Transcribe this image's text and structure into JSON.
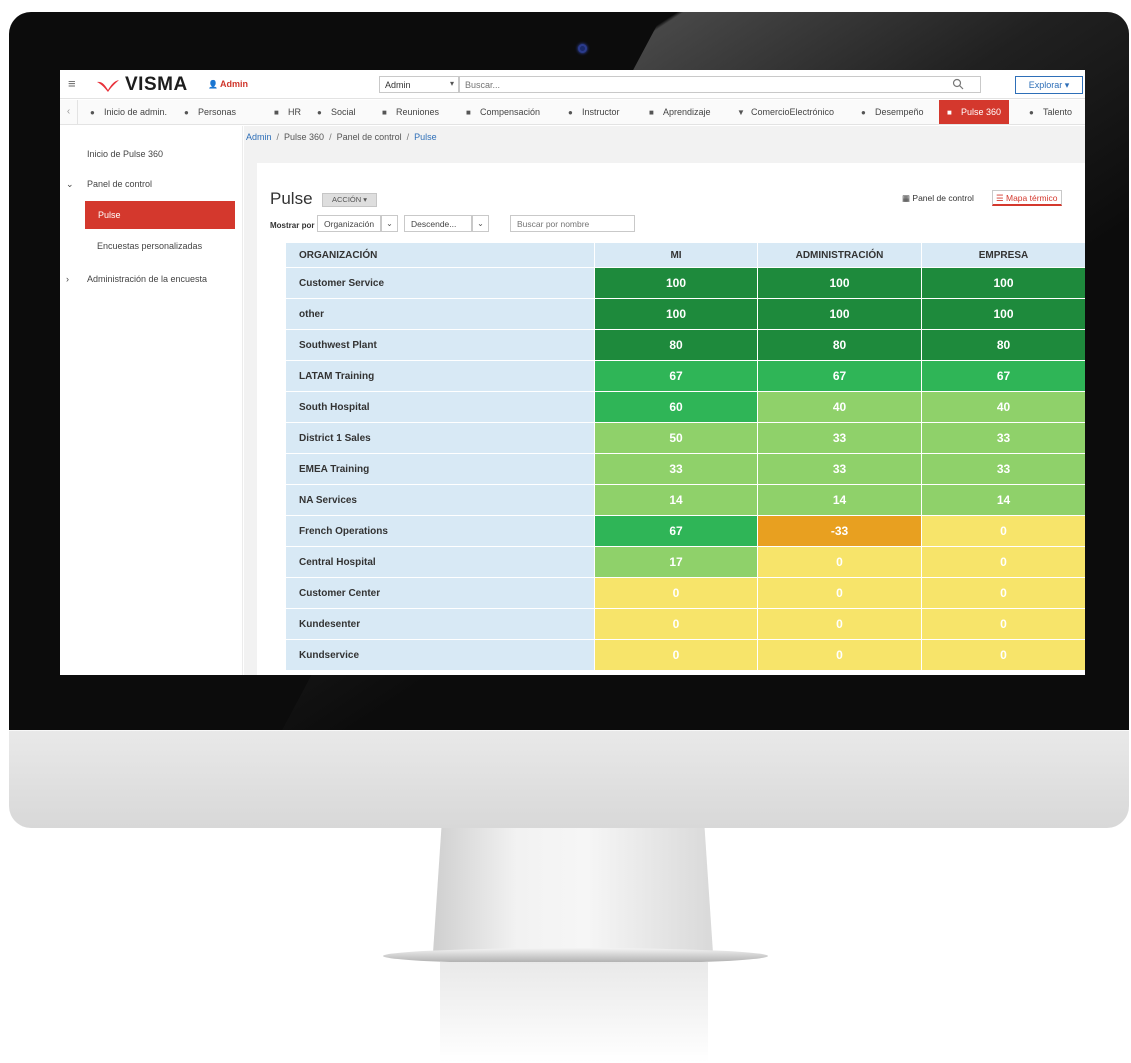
{
  "topbar": {
    "logo_text": "VISMA",
    "admin_label": "Admin",
    "scope_select": "Admin",
    "search_placeholder": "Buscar...",
    "explore_label": "Explorar"
  },
  "nav": {
    "items": [
      {
        "label": "Inicio de admin.",
        "icon": "home-admin-icon"
      },
      {
        "label": "Personas",
        "icon": "people-icon"
      },
      {
        "label": "HR",
        "icon": "hr-icon"
      },
      {
        "label": "Social",
        "icon": "social-icon"
      },
      {
        "label": "Reuniones",
        "icon": "meetings-icon"
      },
      {
        "label": "Compensación",
        "icon": "compensation-icon"
      },
      {
        "label": "Instructor",
        "icon": "instructor-icon"
      },
      {
        "label": "Aprendizaje",
        "icon": "learning-icon"
      },
      {
        "label": "ComercioElectrónico",
        "icon": "ecommerce-icon"
      },
      {
        "label": "Desempeño",
        "icon": "performance-icon"
      },
      {
        "label": "Pulse 360",
        "icon": "pulse-icon",
        "active": true
      },
      {
        "label": "Talento",
        "icon": "talent-icon"
      }
    ]
  },
  "sidebar": {
    "home": "Inicio de Pulse 360",
    "dashboard": "Panel de control",
    "active": "Pulse",
    "custom_surveys": "Encuestas personalizadas",
    "survey_admin": "Administración de la encuesta"
  },
  "breadcrumb": [
    "Admin",
    "Pulse 360",
    "Panel de control",
    "Pulse"
  ],
  "main": {
    "title": "Pulse",
    "action_label": "ACCIÓN",
    "view_dashboard": "Panel de control",
    "view_heatmap": "Mapa térmico",
    "show_by_label": "Mostrar por",
    "group_select": "Organización",
    "sort_select": "Descende...",
    "name_search_placeholder": "Buscar por nombre"
  },
  "heatmap": {
    "columns": [
      "ORGANIZACIÓN",
      "MI",
      "ADMINISTRACIÓN",
      "EMPRESA"
    ],
    "rows": [
      {
        "org": "Customer Service",
        "values": [
          "100",
          "100",
          "100"
        ]
      },
      {
        "org": "other",
        "values": [
          "100",
          "100",
          "100"
        ]
      },
      {
        "org": "Southwest Plant",
        "values": [
          "80",
          "80",
          "80"
        ]
      },
      {
        "org": "LATAM Training",
        "values": [
          "67",
          "67",
          "67"
        ]
      },
      {
        "org": "South Hospital",
        "values": [
          "60",
          "40",
          "40"
        ]
      },
      {
        "org": "District 1 Sales",
        "values": [
          "50",
          "33",
          "33"
        ]
      },
      {
        "org": "EMEA Training",
        "values": [
          "33",
          "33",
          "33"
        ]
      },
      {
        "org": "NA Services",
        "values": [
          "14",
          "14",
          "14"
        ]
      },
      {
        "org": "French Operations",
        "values": [
          "67",
          "-33",
          "0"
        ]
      },
      {
        "org": "Central Hospital",
        "values": [
          "17",
          "0",
          "0"
        ]
      },
      {
        "org": "Customer Center",
        "values": [
          "0",
          "0",
          "0"
        ]
      },
      {
        "org": "Kundesenter",
        "values": [
          "0",
          "0",
          "0"
        ]
      },
      {
        "org": "Kundservice",
        "values": [
          "0",
          "0",
          "0"
        ]
      }
    ],
    "colors": {
      "dark_green": "#1e8a3c",
      "green": "#2fb557",
      "light_green": "#8fd16a",
      "orange": "#e8a020",
      "yellow": "#f7e46a"
    }
  }
}
